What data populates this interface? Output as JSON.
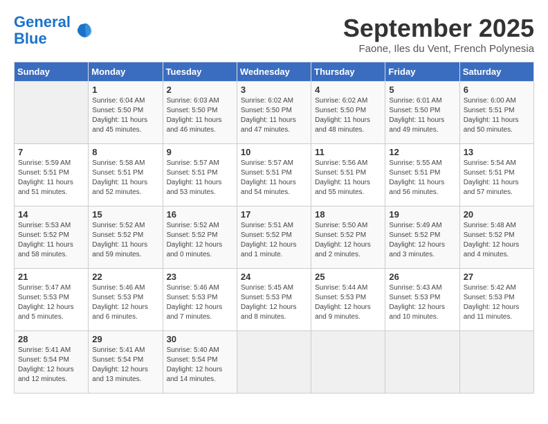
{
  "header": {
    "logo_line1": "General",
    "logo_line2": "Blue",
    "month": "September 2025",
    "location": "Faone, Iles du Vent, French Polynesia"
  },
  "weekdays": [
    "Sunday",
    "Monday",
    "Tuesday",
    "Wednesday",
    "Thursday",
    "Friday",
    "Saturday"
  ],
  "weeks": [
    [
      {
        "day": "",
        "sunrise": "",
        "sunset": "",
        "daylight": ""
      },
      {
        "day": "1",
        "sunrise": "6:04 AM",
        "sunset": "5:50 PM",
        "daylight": "11 hours and 45 minutes."
      },
      {
        "day": "2",
        "sunrise": "6:03 AM",
        "sunset": "5:50 PM",
        "daylight": "11 hours and 46 minutes."
      },
      {
        "day": "3",
        "sunrise": "6:02 AM",
        "sunset": "5:50 PM",
        "daylight": "11 hours and 47 minutes."
      },
      {
        "day": "4",
        "sunrise": "6:02 AM",
        "sunset": "5:50 PM",
        "daylight": "11 hours and 48 minutes."
      },
      {
        "day": "5",
        "sunrise": "6:01 AM",
        "sunset": "5:50 PM",
        "daylight": "11 hours and 49 minutes."
      },
      {
        "day": "6",
        "sunrise": "6:00 AM",
        "sunset": "5:51 PM",
        "daylight": "11 hours and 50 minutes."
      }
    ],
    [
      {
        "day": "7",
        "sunrise": "5:59 AM",
        "sunset": "5:51 PM",
        "daylight": "11 hours and 51 minutes."
      },
      {
        "day": "8",
        "sunrise": "5:58 AM",
        "sunset": "5:51 PM",
        "daylight": "11 hours and 52 minutes."
      },
      {
        "day": "9",
        "sunrise": "5:57 AM",
        "sunset": "5:51 PM",
        "daylight": "11 hours and 53 minutes."
      },
      {
        "day": "10",
        "sunrise": "5:57 AM",
        "sunset": "5:51 PM",
        "daylight": "11 hours and 54 minutes."
      },
      {
        "day": "11",
        "sunrise": "5:56 AM",
        "sunset": "5:51 PM",
        "daylight": "11 hours and 55 minutes."
      },
      {
        "day": "12",
        "sunrise": "5:55 AM",
        "sunset": "5:51 PM",
        "daylight": "11 hours and 56 minutes."
      },
      {
        "day": "13",
        "sunrise": "5:54 AM",
        "sunset": "5:51 PM",
        "daylight": "11 hours and 57 minutes."
      }
    ],
    [
      {
        "day": "14",
        "sunrise": "5:53 AM",
        "sunset": "5:52 PM",
        "daylight": "11 hours and 58 minutes."
      },
      {
        "day": "15",
        "sunrise": "5:52 AM",
        "sunset": "5:52 PM",
        "daylight": "11 hours and 59 minutes."
      },
      {
        "day": "16",
        "sunrise": "5:52 AM",
        "sunset": "5:52 PM",
        "daylight": "12 hours and 0 minutes."
      },
      {
        "day": "17",
        "sunrise": "5:51 AM",
        "sunset": "5:52 PM",
        "daylight": "12 hours and 1 minute."
      },
      {
        "day": "18",
        "sunrise": "5:50 AM",
        "sunset": "5:52 PM",
        "daylight": "12 hours and 2 minutes."
      },
      {
        "day": "19",
        "sunrise": "5:49 AM",
        "sunset": "5:52 PM",
        "daylight": "12 hours and 3 minutes."
      },
      {
        "day": "20",
        "sunrise": "5:48 AM",
        "sunset": "5:52 PM",
        "daylight": "12 hours and 4 minutes."
      }
    ],
    [
      {
        "day": "21",
        "sunrise": "5:47 AM",
        "sunset": "5:53 PM",
        "daylight": "12 hours and 5 minutes."
      },
      {
        "day": "22",
        "sunrise": "5:46 AM",
        "sunset": "5:53 PM",
        "daylight": "12 hours and 6 minutes."
      },
      {
        "day": "23",
        "sunrise": "5:46 AM",
        "sunset": "5:53 PM",
        "daylight": "12 hours and 7 minutes."
      },
      {
        "day": "24",
        "sunrise": "5:45 AM",
        "sunset": "5:53 PM",
        "daylight": "12 hours and 8 minutes."
      },
      {
        "day": "25",
        "sunrise": "5:44 AM",
        "sunset": "5:53 PM",
        "daylight": "12 hours and 9 minutes."
      },
      {
        "day": "26",
        "sunrise": "5:43 AM",
        "sunset": "5:53 PM",
        "daylight": "12 hours and 10 minutes."
      },
      {
        "day": "27",
        "sunrise": "5:42 AM",
        "sunset": "5:53 PM",
        "daylight": "12 hours and 11 minutes."
      }
    ],
    [
      {
        "day": "28",
        "sunrise": "5:41 AM",
        "sunset": "5:54 PM",
        "daylight": "12 hours and 12 minutes."
      },
      {
        "day": "29",
        "sunrise": "5:41 AM",
        "sunset": "5:54 PM",
        "daylight": "12 hours and 13 minutes."
      },
      {
        "day": "30",
        "sunrise": "5:40 AM",
        "sunset": "5:54 PM",
        "daylight": "12 hours and 14 minutes."
      },
      {
        "day": "",
        "sunrise": "",
        "sunset": "",
        "daylight": ""
      },
      {
        "day": "",
        "sunrise": "",
        "sunset": "",
        "daylight": ""
      },
      {
        "day": "",
        "sunrise": "",
        "sunset": "",
        "daylight": ""
      },
      {
        "day": "",
        "sunrise": "",
        "sunset": "",
        "daylight": ""
      }
    ]
  ]
}
